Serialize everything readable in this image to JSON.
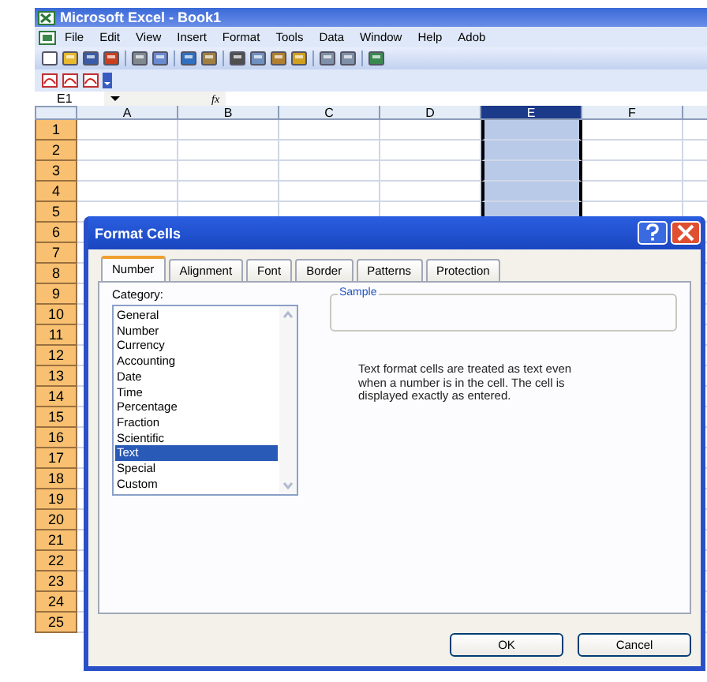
{
  "window": {
    "title": "Microsoft Excel - Book1"
  },
  "menu": [
    {
      "label": "File"
    },
    {
      "label": "Edit"
    },
    {
      "label": "View"
    },
    {
      "label": "Insert"
    },
    {
      "label": "Format"
    },
    {
      "label": "Tools"
    },
    {
      "label": "Data"
    },
    {
      "label": "Window"
    },
    {
      "label": "Help"
    },
    {
      "label": "Adob"
    }
  ],
  "name_box": {
    "value": "E1"
  },
  "formula_bar": {
    "label": "fx"
  },
  "columns": [
    {
      "label": "A",
      "selected": false
    },
    {
      "label": "B",
      "selected": false
    },
    {
      "label": "C",
      "selected": false
    },
    {
      "label": "D",
      "selected": false
    },
    {
      "label": "E",
      "selected": true
    },
    {
      "label": "F",
      "selected": false
    }
  ],
  "rows": [
    "1",
    "2",
    "3",
    "4",
    "5",
    "6",
    "7",
    "8",
    "9",
    "10",
    "11",
    "12",
    "13",
    "14",
    "15",
    "16",
    "17",
    "18",
    "19",
    "20",
    "21",
    "22",
    "23",
    "24",
    "25"
  ],
  "dialog": {
    "title": "Format Cells",
    "tabs": [
      {
        "label": "Number",
        "selected": true
      },
      {
        "label": "Alignment",
        "selected": false
      },
      {
        "label": "Font",
        "selected": false
      },
      {
        "label": "Border",
        "selected": false
      },
      {
        "label": "Patterns",
        "selected": false
      },
      {
        "label": "Protection",
        "selected": false
      }
    ],
    "category_label": "Category:",
    "categories": [
      {
        "label": "General",
        "selected": false
      },
      {
        "label": "Number",
        "selected": false
      },
      {
        "label": "Currency",
        "selected": false
      },
      {
        "label": "Accounting",
        "selected": false
      },
      {
        "label": "Date",
        "selected": false
      },
      {
        "label": "Time",
        "selected": false
      },
      {
        "label": "Percentage",
        "selected": false
      },
      {
        "label": "Fraction",
        "selected": false
      },
      {
        "label": "Scientific",
        "selected": false
      },
      {
        "label": "Text",
        "selected": true
      },
      {
        "label": "Special",
        "selected": false
      },
      {
        "label": "Custom",
        "selected": false
      }
    ],
    "sample_label": "Sample",
    "description": "Text format cells are treated as text even when a number is in the cell.  The cell is displayed exactly as entered.",
    "buttons": [
      "OK",
      "Cancel"
    ]
  }
}
